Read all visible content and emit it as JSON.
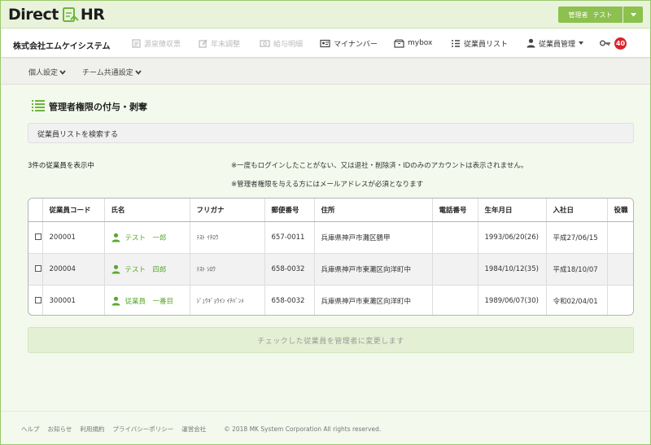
{
  "app": {
    "logo_left": "Direct",
    "logo_right": "HR",
    "user_button": {
      "role": "管理者",
      "name": "テスト"
    }
  },
  "navbar": {
    "company": "株式会社エムケイシステム",
    "items": [
      {
        "label": "源泉徴収票",
        "icon": "document-icon",
        "disabled": true
      },
      {
        "label": "年末調整",
        "icon": "pencil-icon",
        "disabled": true
      },
      {
        "label": "給与明細",
        "icon": "money-icon",
        "disabled": true
      },
      {
        "label": "マイナンバー",
        "icon": "id-card-icon",
        "disabled": false
      },
      {
        "label": "mybox",
        "icon": "box-icon",
        "disabled": false
      },
      {
        "label": "従業員リスト",
        "icon": "list-icon",
        "disabled": false
      },
      {
        "label": "従業員管理",
        "icon": "person-icon",
        "disabled": false
      }
    ],
    "notification_count": "40"
  },
  "subnav": {
    "items": [
      {
        "label": "個人設定"
      },
      {
        "label": "チーム共通設定"
      }
    ]
  },
  "page": {
    "title": "管理者権限の付与・剥奪",
    "search_panel_label": "従業員リストを検索する",
    "result_count_text": "3件の従業員を表示中",
    "notes": [
      "※一度もログインしたことがない、又は退社・削除済・IDのみのアカウントは表示されません。",
      "※管理者権限を与える方にはメールアドレスが必須となります"
    ],
    "change_button": "チェックした従業員を管理者に変更します"
  },
  "table": {
    "headers": {
      "code": "従業員コード",
      "name": "氏名",
      "kana": "フリガナ",
      "postal": "郵便番号",
      "address": "住所",
      "phone": "電話番号",
      "birth": "生年月日",
      "hire": "入社日",
      "position": "役職"
    },
    "rows": [
      {
        "code": "200001",
        "name": "テスト　一郎",
        "kana": "ﾃｽﾄ ｲﾁﾛｳ",
        "postal": "657-0011",
        "address": "兵庫県神戸市灘区鶴甲",
        "phone": "",
        "birth": "1993/06/20(26)",
        "hire": "平成27/06/15",
        "position": ""
      },
      {
        "code": "200004",
        "name": "テスト　四郎",
        "kana": "ﾃｽﾄ ｼﾛｳ",
        "postal": "658-0032",
        "address": "兵庫県神戸市東灘区向洋町中",
        "phone": "",
        "birth": "1984/10/12(35)",
        "hire": "平成18/10/07",
        "position": ""
      },
      {
        "code": "300001",
        "name": "従業員　一番目",
        "kana": "ｼﾞｭｳｷﾞｮｳｲﾝ ｲﾁﾊﾞﾝﾒ",
        "postal": "658-0032",
        "address": "兵庫県神戸市東灘区向洋町中",
        "phone": "",
        "birth": "1989/06/07(30)",
        "hire": "令和02/04/01",
        "position": ""
      }
    ]
  },
  "footer": {
    "links": [
      "ヘルプ",
      "お知らせ",
      "利用規約",
      "プライバシーポリシー",
      "運営会社"
    ],
    "copyright": "© 2018 MK System Corporation All rights reserved."
  },
  "colors": {
    "accent": "#8cc04f",
    "name_link": "#5ba72f",
    "badge": "#d9252a"
  }
}
